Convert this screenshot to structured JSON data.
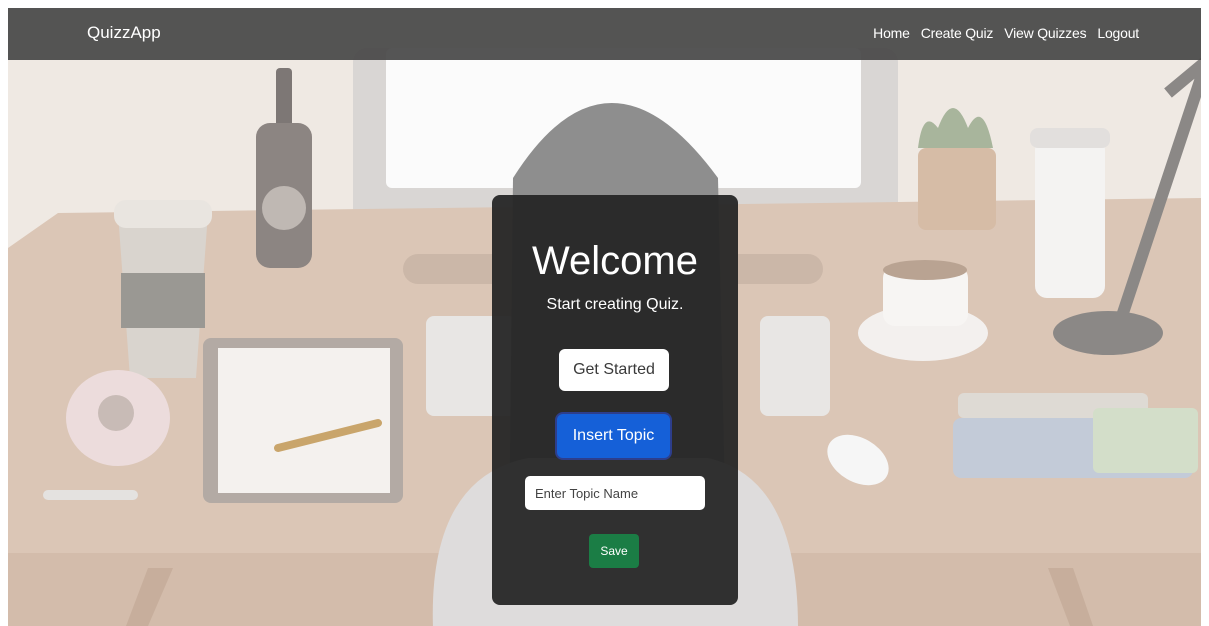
{
  "navbar": {
    "brand": "QuizzApp",
    "links": [
      "Home",
      "Create Quiz",
      "View Quizzes",
      "Logout"
    ]
  },
  "hero": {
    "title": "Welcome",
    "subtitle": "Start creating Quiz.",
    "get_started_label": "Get Started",
    "insert_topic_label": "Insert Topic",
    "topic_input": {
      "placeholder": "Enter Topic Name",
      "value": ""
    },
    "save_label": "Save"
  },
  "colors": {
    "navbar_bg": "#484848",
    "card_bg": "#262626",
    "primary_blue": "#1560d8",
    "success_green": "#1b7d45"
  },
  "icons": [
    "background-illustration"
  ]
}
